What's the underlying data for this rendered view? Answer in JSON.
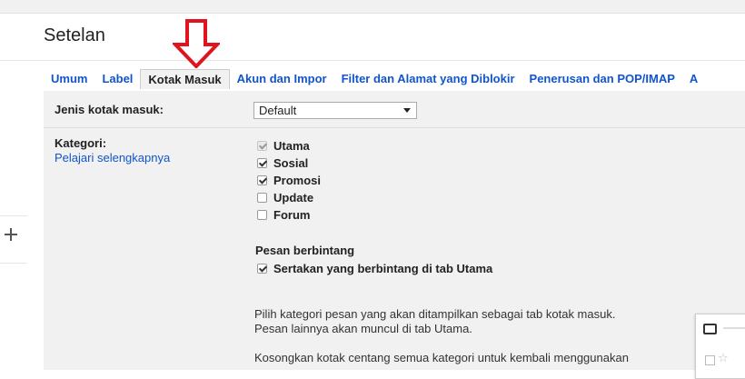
{
  "page": {
    "title": "Setelan"
  },
  "tabs": [
    {
      "label": "Umum",
      "active": false
    },
    {
      "label": "Label",
      "active": false
    },
    {
      "label": "Kotak Masuk",
      "active": true
    },
    {
      "label": "Akun dan Impor",
      "active": false
    },
    {
      "label": "Filter dan Alamat yang Diblokir",
      "active": false
    },
    {
      "label": "Penerusan dan POP/IMAP",
      "active": false
    },
    {
      "label": "A",
      "active": false
    }
  ],
  "inbox_type": {
    "label": "Jenis kotak masuk:",
    "value": "Default"
  },
  "categories": {
    "label": "Kategori:",
    "learn_more": "Pelajari selengkapnya",
    "items": [
      {
        "label": "Utama",
        "checked": true,
        "disabled": true
      },
      {
        "label": "Sosial",
        "checked": true,
        "disabled": false
      },
      {
        "label": "Promosi",
        "checked": true,
        "disabled": false
      },
      {
        "label": "Update",
        "checked": false,
        "disabled": false
      },
      {
        "label": "Forum",
        "checked": false,
        "disabled": false
      }
    ]
  },
  "starred": {
    "heading": "Pesan berbintang",
    "option": {
      "label": "Sertakan yang berbintang di tab Utama",
      "checked": true
    }
  },
  "description": {
    "line1": "Pilih kategori pesan yang akan ditampilkan sebagai tab kotak masuk.",
    "line2": "Pesan lainnya akan muncul di tab Utama.",
    "line3": "Kosongkan kotak centang semua kategori untuk kembali menggunakan"
  },
  "colors": {
    "link": "#1155cc",
    "panel": "#f1f1f1",
    "arrow": "#e0141e"
  }
}
